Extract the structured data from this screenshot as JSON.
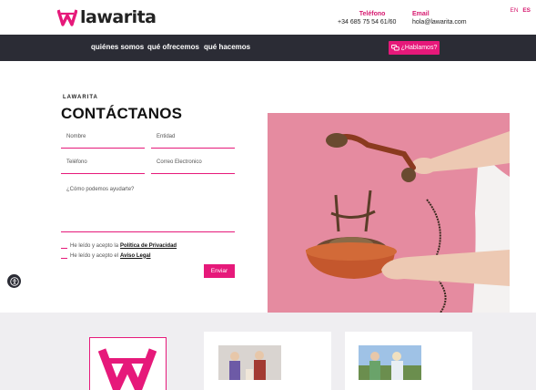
{
  "header": {
    "logo_text": "lawarita",
    "phone_label": "Teléfono",
    "phone_value": "+34 685 75 54 61/60",
    "email_label": "Email",
    "email_value": "hola@lawarita.com",
    "lang_en": "EN",
    "lang_es": "ES"
  },
  "nav": {
    "items": [
      "quiénes somos",
      "qué ofrecemos",
      "qué hacemos"
    ],
    "cta_label": "¿Hablamos?"
  },
  "contact": {
    "eyebrow": "LAWARITA",
    "heading": "CONTÁCTANOS",
    "fields": {
      "name": "Nombre",
      "entity": "Entidad",
      "phone": "Teléfono",
      "email": "Correo Electronico",
      "message": "¿Cómo podemos ayudarte?"
    },
    "privacy_text": "He leído y acepto la",
    "privacy_link": "Política de Privacidad",
    "legal_text": "He leído y acepto el",
    "legal_link": "Aviso Legal",
    "send_label": "Enviar"
  },
  "colors": {
    "brand": "#e6197a",
    "nav_bg": "#2b2c35",
    "photo_bg": "#e58ba0",
    "band_bg": "#efeef1"
  },
  "icons": {
    "accessibility": "accessibility-icon",
    "chat": "chat-icon"
  }
}
